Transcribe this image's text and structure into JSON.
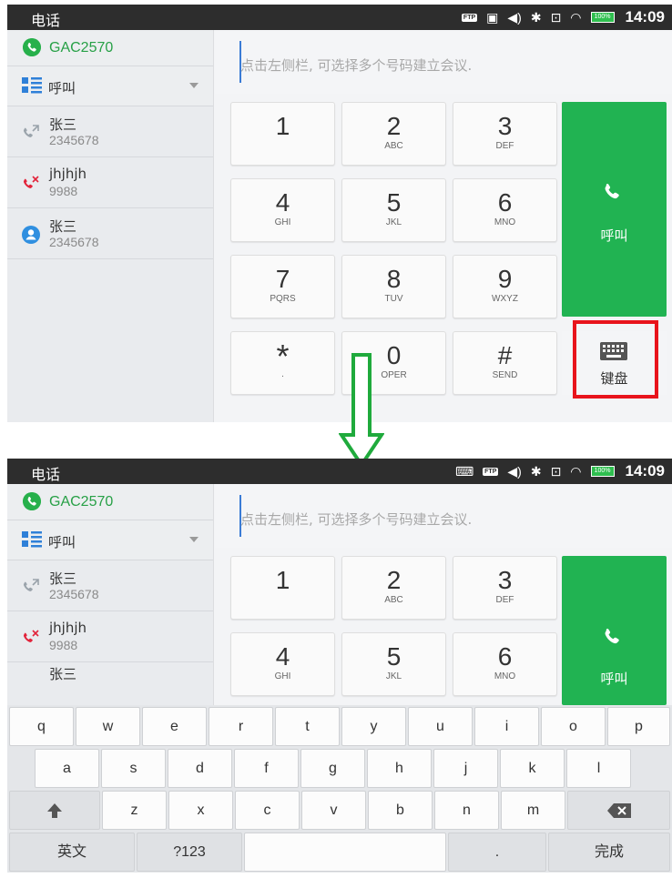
{
  "status_bar": {
    "app_title": "电话",
    "ftp_label": "FTP",
    "battery_label": "100%",
    "time": "14:09"
  },
  "sidebar": {
    "account": "GAC2570",
    "mode_label": "呼叫",
    "history": [
      {
        "name": "张三",
        "number": "2345678",
        "type": "outgoing-call-icon"
      },
      {
        "name": "jhjhjh",
        "number": "9988",
        "type": "missed-call-icon"
      },
      {
        "name": "张三",
        "number": "2345678",
        "type": "contact-icon"
      }
    ],
    "partial_name": "张三"
  },
  "dial_input": {
    "placeholder": "点击左侧栏, 可选择多个号码建立会议."
  },
  "dialpad": {
    "keys": [
      {
        "digit": "1",
        "letters": ""
      },
      {
        "digit": "2",
        "letters": "ABC"
      },
      {
        "digit": "3",
        "letters": "DEF"
      },
      {
        "digit": "4",
        "letters": "GHI"
      },
      {
        "digit": "5",
        "letters": "JKL"
      },
      {
        "digit": "6",
        "letters": "MNO"
      },
      {
        "digit": "7",
        "letters": "PQRS"
      },
      {
        "digit": "8",
        "letters": "TUV"
      },
      {
        "digit": "9",
        "letters": "WXYZ"
      },
      {
        "digit": "*",
        "letters": "."
      },
      {
        "digit": "0",
        "letters": "OPER"
      },
      {
        "digit": "#",
        "letters": "SEND"
      }
    ],
    "call_label": "呼叫",
    "keyboard_label": "键盘"
  },
  "keyboard": {
    "row1": [
      "q",
      "w",
      "e",
      "r",
      "t",
      "y",
      "u",
      "i",
      "o",
      "p"
    ],
    "row2": [
      "a",
      "s",
      "d",
      "f",
      "g",
      "h",
      "j",
      "k",
      "l"
    ],
    "row3": [
      "z",
      "x",
      "c",
      "v",
      "b",
      "n",
      "m"
    ],
    "lang_key": "英文",
    "symbols_key": "?123",
    "period_key": ".",
    "done_key": "完成"
  },
  "colors": {
    "accent_green": "#21b352",
    "highlight_red": "#e8141c",
    "arrow_green": "#1faa3c",
    "status_bar": "#2d2d2d"
  }
}
